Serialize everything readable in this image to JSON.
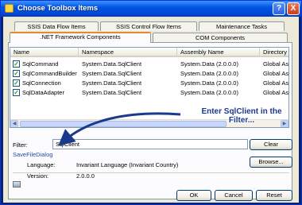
{
  "window": {
    "title": "Choose Toolbox Items"
  },
  "titlebar": {
    "help_glyph": "?",
    "close_glyph": "X"
  },
  "tabs_row1": [
    "SSIS Data Flow Items",
    "SSIS Control Flow Items",
    "Maintenance Tasks"
  ],
  "tabs_row2": [
    ".NET Framework Components",
    "COM Components"
  ],
  "columns": [
    "Name",
    "Namespace",
    "Assembly Name",
    "Directory"
  ],
  "rows": [
    {
      "checked": true,
      "name": "SqlCommand",
      "namespace": "System.Data.SqlClient",
      "assembly": "System.Data (2.0.0.0)",
      "directory": "Global Asse..."
    },
    {
      "checked": true,
      "name": "SqlCommandBuilder",
      "namespace": "System.Data.SqlClient",
      "assembly": "System.Data (2.0.0.0)",
      "directory": "Global Asse..."
    },
    {
      "checked": true,
      "name": "SqlConnection",
      "namespace": "System.Data.SqlClient",
      "assembly": "System.Data (2.0.0.0)",
      "directory": "Global Asse..."
    },
    {
      "checked": true,
      "name": "SqlDataAdapter",
      "namespace": "System.Data.SqlClient",
      "assembly": "System.Data (2.0.0.0)",
      "directory": "Global Asse..."
    }
  ],
  "callout": {
    "line1": "Enter SqlClient in the",
    "line2": "Filter..."
  },
  "filter": {
    "label": "Filter:",
    "value": "SqlClient",
    "clear_label": "Clear"
  },
  "component": {
    "name": "SaveFileDialog",
    "language_label": "Language:",
    "language_value": "Invariant Language (Invariant Country)",
    "version_label": "Version:",
    "version_value": "2.0.0.0",
    "browse_label": "Browse..."
  },
  "buttons": {
    "ok": "OK",
    "cancel": "Cancel",
    "reset": "Reset"
  },
  "colors": {
    "title_bar": "#0055e5",
    "dialog_bg": "#ece9d8",
    "active_tab_accent": "#e68b2c",
    "callout_text": "#1a3a8c",
    "arrow": "#1a3a8c"
  }
}
